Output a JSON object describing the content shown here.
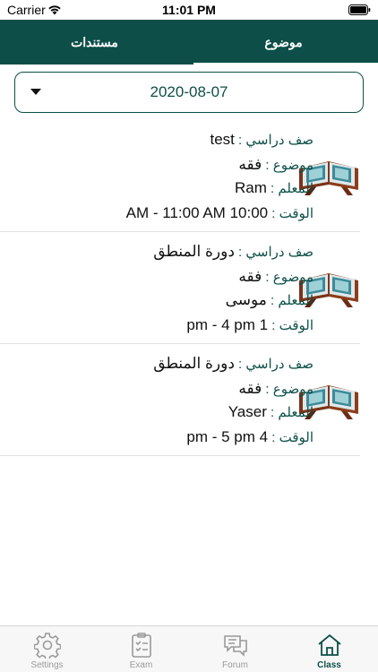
{
  "status_bar": {
    "carrier": "Carrier",
    "time": "11:01 PM"
  },
  "tabs": [
    {
      "label": "مستندات",
      "active": false
    },
    {
      "label": "موضوع",
      "active": true
    }
  ],
  "date_picker": {
    "value": "2020-08-07"
  },
  "labels": {
    "class": "صف دراسي : ",
    "subject": "موضوع : ",
    "teacher": "المعلم : ",
    "time": "الوقت : "
  },
  "items": [
    {
      "class": "test",
      "subject": "فقه",
      "teacher": "Ram",
      "time": "AM - 11:00 AM 10:00"
    },
    {
      "class": "دورة المنطق",
      "subject": "فقه",
      "teacher": "موسى",
      "time": "pm - 4 pm 1"
    },
    {
      "class": "دورة المنطق",
      "subject": "فقه",
      "teacher": "Yaser",
      "time": "pm  - 5 pm 4"
    }
  ],
  "bottom_tabs": [
    {
      "label": "Settings",
      "icon": "gear-icon",
      "active": false
    },
    {
      "label": "Exam",
      "icon": "clipboard-icon",
      "active": false
    },
    {
      "label": "Forum",
      "icon": "chat-icon",
      "active": false
    },
    {
      "label": "Class",
      "icon": "home-icon",
      "active": true
    }
  ],
  "colors": {
    "primary": "#0d4f48",
    "inactive": "#9a9a9a"
  }
}
